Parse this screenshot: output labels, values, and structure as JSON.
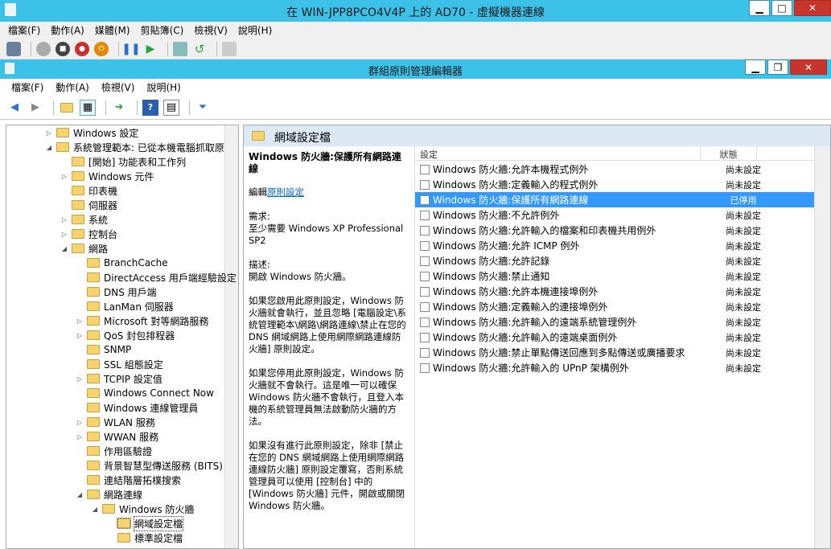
{
  "vm": {
    "title": "在 WIN-JPP8PCO4V4P 上的 AD70 - 虛擬機器連線",
    "menu": [
      "檔案(F)",
      "動作(A)",
      "媒體(M)",
      "剪貼簿(C)",
      "檢視(V)",
      "說明(H)"
    ]
  },
  "gpe": {
    "title": "群組原則管理編輯器",
    "menu": [
      "檔案(F)",
      "動作(A)",
      "檢視(V)",
      "說明(H)"
    ]
  },
  "tree": [
    {
      "label": "Windows 設定",
      "level": 0,
      "exp": "▷"
    },
    {
      "label": "系統管理範本: 已從本機電腦抓取原",
      "level": 0,
      "exp": "◢"
    },
    {
      "label": "[開始] 功能表和工作列",
      "level": 1,
      "exp": ""
    },
    {
      "label": "Windows 元件",
      "level": 1,
      "exp": "▷"
    },
    {
      "label": "印表機",
      "level": 1,
      "exp": ""
    },
    {
      "label": "伺服器",
      "level": 1,
      "exp": ""
    },
    {
      "label": "系統",
      "level": 1,
      "exp": "▷"
    },
    {
      "label": "控制台",
      "level": 1,
      "exp": "▷"
    },
    {
      "label": "網路",
      "level": 1,
      "exp": "◢"
    },
    {
      "label": "BranchCache",
      "level": 2,
      "exp": ""
    },
    {
      "label": "DirectAccess 用戶端經驗設定",
      "level": 2,
      "exp": ""
    },
    {
      "label": "DNS 用戶端",
      "level": 2,
      "exp": ""
    },
    {
      "label": "LanMan 伺服器",
      "level": 2,
      "exp": ""
    },
    {
      "label": "Microsoft 對等網路服務",
      "level": 2,
      "exp": "▷"
    },
    {
      "label": "QoS 封包排程器",
      "level": 2,
      "exp": "▷"
    },
    {
      "label": "SNMP",
      "level": 2,
      "exp": ""
    },
    {
      "label": "SSL 組態設定",
      "level": 2,
      "exp": ""
    },
    {
      "label": "TCPIP 設定值",
      "level": 2,
      "exp": "▷"
    },
    {
      "label": "Windows Connect Now",
      "level": 2,
      "exp": ""
    },
    {
      "label": "Windows 連線管理員",
      "level": 2,
      "exp": ""
    },
    {
      "label": "WLAN 服務",
      "level": 2,
      "exp": "▷"
    },
    {
      "label": "WWAN 服務",
      "level": 2,
      "exp": "▷"
    },
    {
      "label": "作用區驗證",
      "level": 2,
      "exp": ""
    },
    {
      "label": "背景智慧型傳送服務 (BITS)",
      "level": 2,
      "exp": ""
    },
    {
      "label": "連結階層拓樸搜索",
      "level": 2,
      "exp": ""
    },
    {
      "label": "網路連線",
      "level": 2,
      "exp": "◢"
    },
    {
      "label": "Windows 防火牆",
      "level": 3,
      "exp": "◢"
    },
    {
      "label": "網域設定檔",
      "level": 4,
      "exp": "",
      "sel": true
    },
    {
      "label": "標準設定檔",
      "level": 4,
      "exp": ""
    }
  ],
  "panel": {
    "header": "網域設定檔",
    "desc_title": "Windows 防火牆:保護所有網路連線",
    "edit_prefix": "編輯",
    "edit_link": "原則設定",
    "req": "需求:\n至少需要 Windows XP Professional SP2",
    "desc": "描述:\n開啟 Windows 防火牆。",
    "p1": "如果您啟用此原則設定，Windows 防火牆就會執行，並且忽略 [電腦設定\\系統管理範本\\網路\\網路連線\\禁止在您的 DNS 網域網路上使用網際網路連線防火牆] 原則設定。",
    "p2": "如果您停用此原則設定，Windows 防火牆就不會執行。這是唯一可以確保 Windows 防火牆不會執行，且登入本機的系統管理員無法啟動防火牆的方法。",
    "p3": "如果沒有進行此原則設定，除非 [禁止在您的 DNS 網域網路上使用網際網路連線防火牆] 原則設定覆寫，否則系統管理員可以使用 [控制台] 中的 [Windows 防火牆] 元件，開啟或關閉 Windows 防火牆。"
  },
  "list": {
    "col1": "設定",
    "col2": "狀態",
    "rows": [
      {
        "name": "Windows 防火牆:允許本機程式例外",
        "state": "尚未設定"
      },
      {
        "name": "Windows 防火牆:定義輸入的程式例外",
        "state": "尚未設定"
      },
      {
        "name": "Windows 防火牆:保護所有網路連線",
        "state": "已停用",
        "sel": true
      },
      {
        "name": "Windows 防火牆:不允許例外",
        "state": "尚未設定"
      },
      {
        "name": "Windows 防火牆:允許輸入的檔案和印表機共用例外",
        "state": "尚未設定"
      },
      {
        "name": "Windows 防火牆:允許 ICMP 例外",
        "state": "尚未設定"
      },
      {
        "name": "Windows 防火牆:允許記錄",
        "state": "尚未設定"
      },
      {
        "name": "Windows 防火牆:禁止通知",
        "state": "尚未設定"
      },
      {
        "name": "Windows 防火牆:允許本機連接埠例外",
        "state": "尚未設定"
      },
      {
        "name": "Windows 防火牆:定義輸入的連接埠例外",
        "state": "尚未設定"
      },
      {
        "name": "Windows 防火牆:允許輸入的遠端系統管理例外",
        "state": "尚未設定"
      },
      {
        "name": "Windows 防火牆:允許輸入的遠端桌面例外",
        "state": "尚未設定"
      },
      {
        "name": "Windows 防火牆:禁止單點傳送回應到多點傳送或廣播要求",
        "state": "尚未設定"
      },
      {
        "name": "Windows 防火牆:允許輸入的 UPnP 架構例外",
        "state": "尚未設定"
      }
    ]
  }
}
